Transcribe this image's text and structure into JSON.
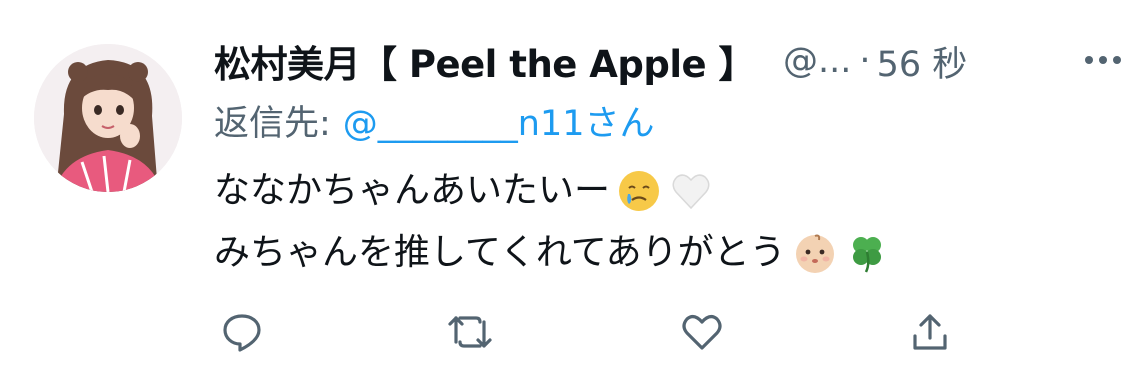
{
  "tweet": {
    "display_name": "松村美月【 Peel the Apple 】",
    "handle": "@...",
    "separator": "·",
    "time": "56 秒",
    "reply": {
      "prefix": "返信先:",
      "mention": "@________n11さん"
    },
    "text_lines": [
      "ななかちゃんあいたいー",
      "みちゃんを推してくれてありがとう"
    ],
    "emojis": {
      "line1": [
        "face-holding-back-tears",
        "white-heart"
      ],
      "line2": [
        "baby-face",
        "four-leaf-clover"
      ]
    }
  },
  "actions": [
    "reply-icon",
    "retweet-icon",
    "like-icon",
    "share-icon"
  ],
  "colors": {
    "text": "#0f1419",
    "secondary": "#536471",
    "link": "#1d9bf0"
  }
}
